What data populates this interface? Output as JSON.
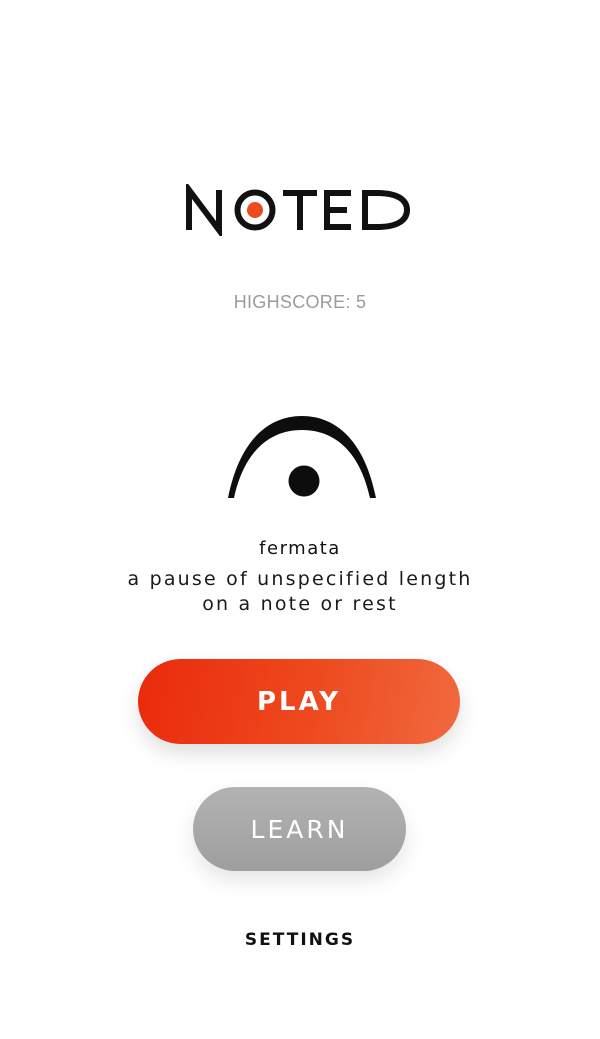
{
  "app": {
    "logo_text": "NOTED",
    "accent_color": "#ee4a1f"
  },
  "highscore": {
    "text": "HIGHSCORE: 5"
  },
  "card": {
    "symbol_icon": "fermata-icon",
    "term": "fermata",
    "definition_line1": "a pause of unspecified length",
    "definition_line2": "on a note or rest"
  },
  "buttons": {
    "play_label": "PLAY",
    "learn_label": "LEARN",
    "settings_label": "SETTINGS"
  }
}
